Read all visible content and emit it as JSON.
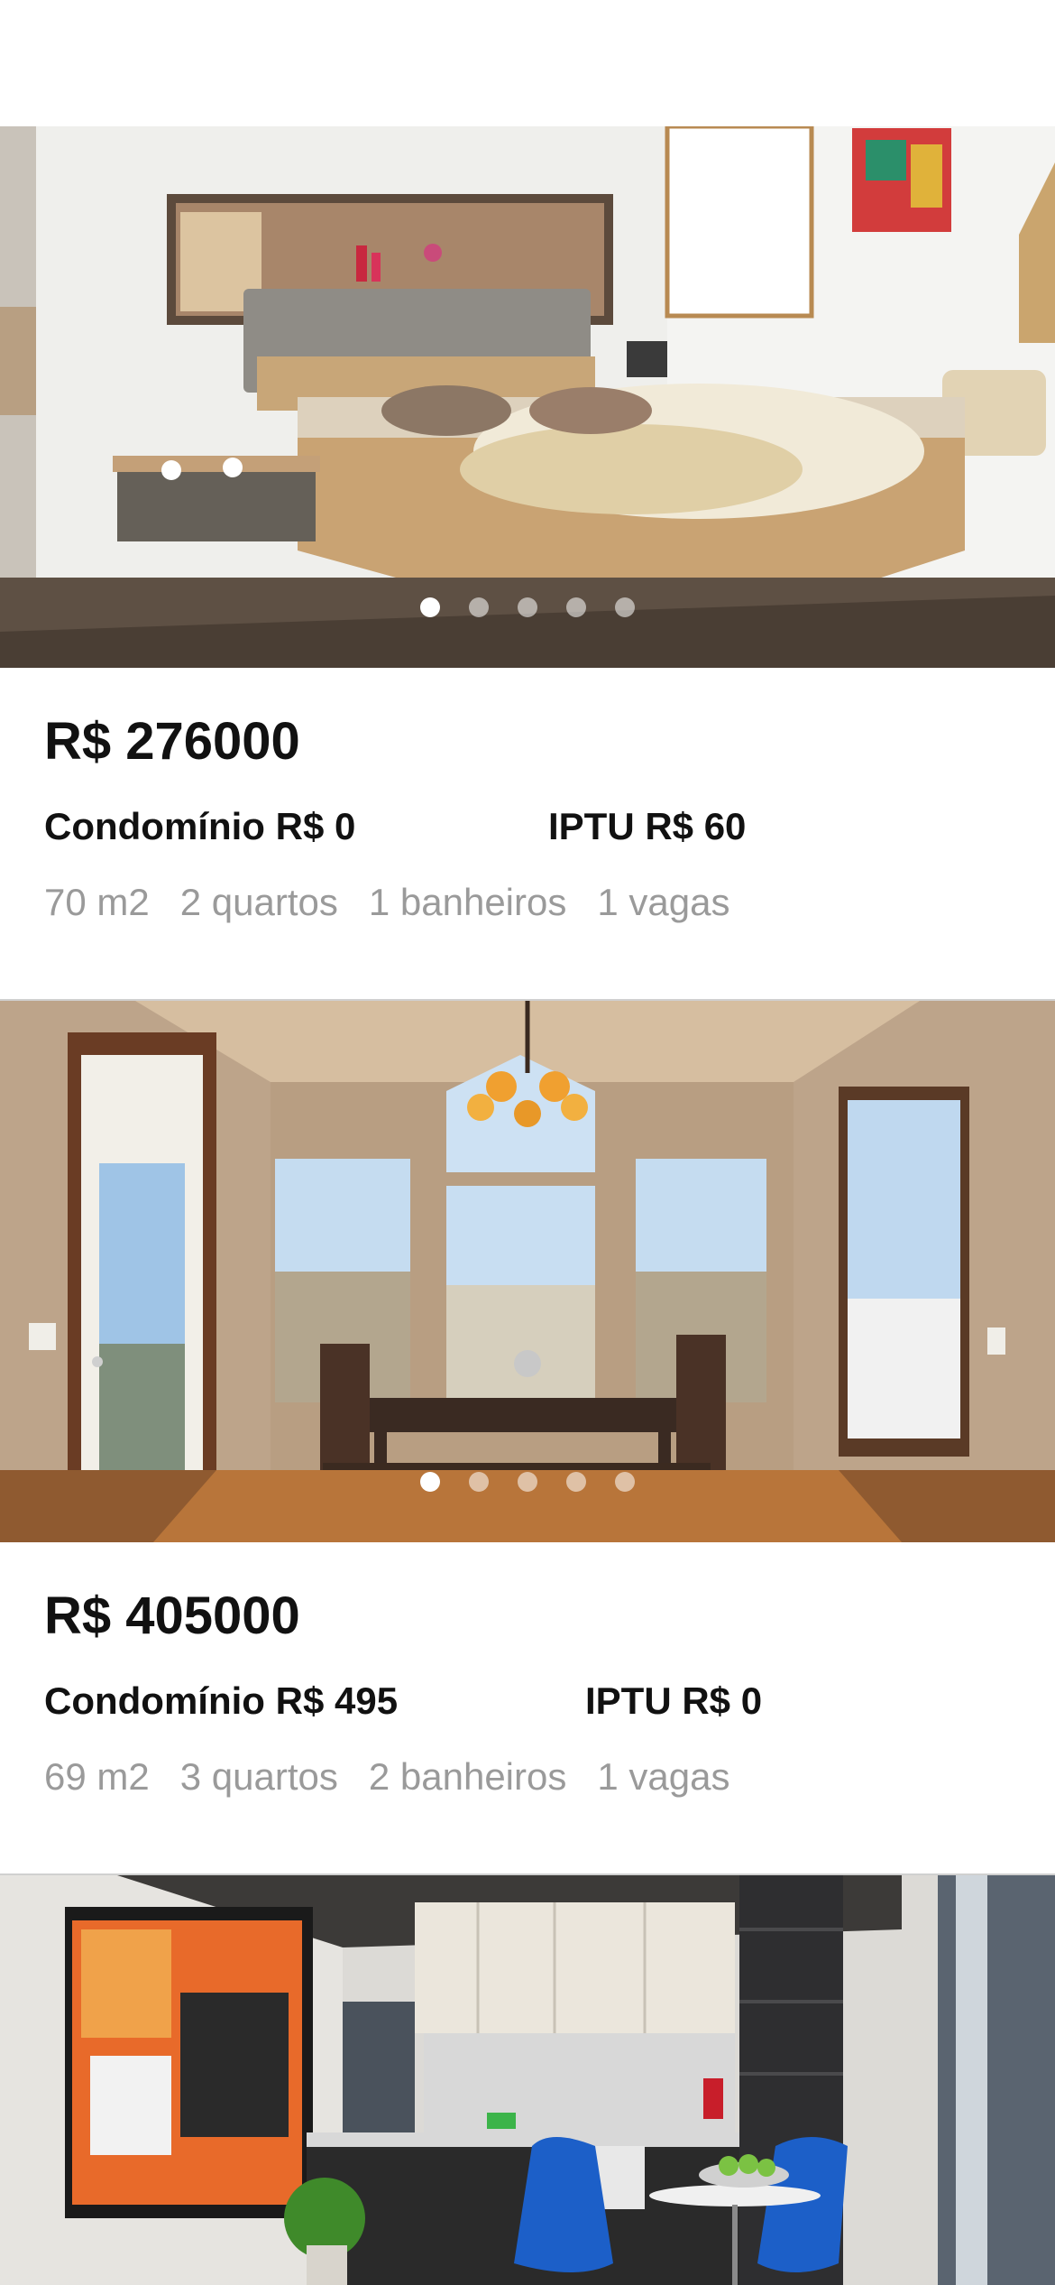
{
  "listings": [
    {
      "price": "R$ 276000",
      "condominio": "Condomínio R$ 0",
      "iptu": "IPTU R$ 60",
      "area": "70 m2",
      "quartos": "2 quartos",
      "banheiros": "1 banheiros",
      "vagas": "1 vagas",
      "photo_count": 5,
      "active_photo": 1
    },
    {
      "price": "R$ 405000",
      "condominio": "Condomínio R$ 495",
      "iptu": "IPTU R$ 0",
      "area": "69 m2",
      "quartos": "3 quartos",
      "banheiros": "2 banheiros",
      "vagas": "1 vagas",
      "photo_count": 5,
      "active_photo": 1
    }
  ]
}
